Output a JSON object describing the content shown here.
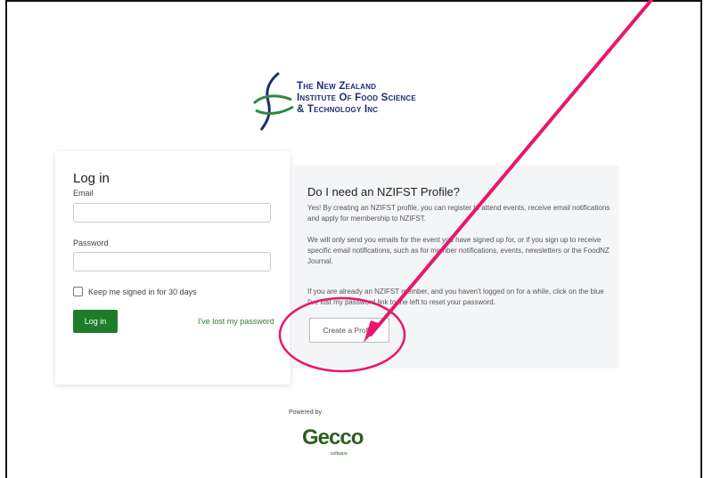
{
  "logo": {
    "lines": [
      "The New Zealand",
      "Institute Of Food Science",
      "& Technology Inc"
    ]
  },
  "login": {
    "title": "Log in",
    "email_label": "Email",
    "email_value": "",
    "password_label": "Password",
    "password_value": "",
    "keep_signed_in": "Keep me signed in for 30 days",
    "login_button": "Log in",
    "lost_password": "I've lost my password"
  },
  "profile": {
    "title": "Do I need an NZIFST Profile?",
    "para1": "Yes! By creating an NZIFST profile, you can register to attend events, receive email notifications and apply for membership to NZIFST.",
    "para2": "We will only send you emails for the event you have signed up for, or if you sign up to receive specific email notifications, such as for member notifications, events, newsletters or the FoodNZ Journal.",
    "para3": "If you are already an NZIFST member, and you haven't logged on for a while, click on the blue I've lost my password link to the left to reset your password.",
    "create_button": "Create a Profile"
  },
  "footer": {
    "powered_by": "Powered by",
    "brand": "Gecco",
    "brand_sub": "software"
  },
  "colors": {
    "annotation": "#e8176e",
    "login_green": "#1e7d2a",
    "logo_blue": "#1c2d73"
  }
}
